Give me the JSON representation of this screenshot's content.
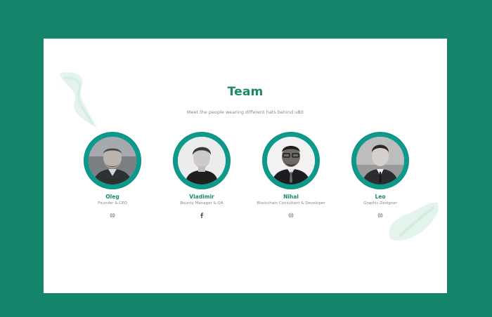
{
  "section": {
    "title": "Team",
    "subtitle": "Meet the people wearing different hats behind uBit"
  },
  "members": [
    {
      "name": "Oleg",
      "role": "Founder & CEO",
      "social_icon": "globe-icon"
    },
    {
      "name": "Vladimir",
      "role": "Bounty Manager & QA",
      "social_icon": "facebook-icon"
    },
    {
      "name": "Nihal",
      "role": "Blockchain Consultant & Developer",
      "social_icon": "globe-icon"
    },
    {
      "name": "Leo",
      "role": "Graphic Designer",
      "social_icon": "globe-icon"
    }
  ],
  "colors": {
    "page_bg": "#14846b",
    "accent": "#1a8a6b",
    "ring": "#0d9a8a",
    "text_muted": "#7d8a96"
  }
}
